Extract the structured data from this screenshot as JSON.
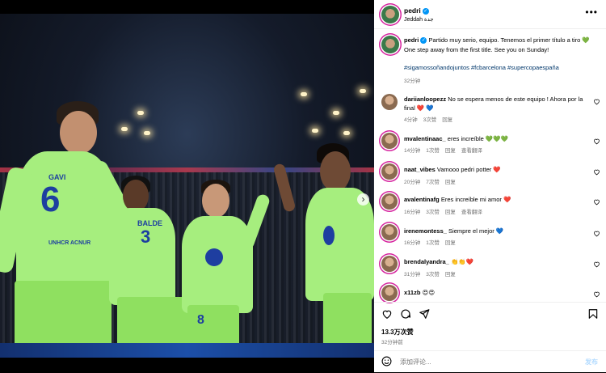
{
  "post": {
    "username": "pedri",
    "location": "Jeddah جدة",
    "caption": "Partido muy serio, equipo. Tenemos el primer título a tiro 💚 One step away from the first title. See you on Sunday!",
    "hashtags": "#sigamossoñandojuntos #fcbarcelona #supercopaespaña",
    "caption_time": "32分钟",
    "more_icon": "more-horizontal-icon",
    "verified_icon": "verified-badge-icon",
    "next_icon": "chevron-right-icon"
  },
  "photo": {
    "players": [
      {
        "name": "GAVI",
        "number": "6"
      },
      {
        "name": "BALDE",
        "number": "3"
      },
      {
        "name": "",
        "number": "8"
      }
    ],
    "sponsor_text": "UNHCR ACNUR"
  },
  "comments": [
    {
      "user": "dariianloopezz",
      "text": "No se espera menos de este equipo ! Ahora por la final ❤️ 💙",
      "time": "4分钟",
      "likes": "3次赞",
      "reply": "回复",
      "translate": ""
    },
    {
      "user": "mvalentinaac_",
      "text": "eres increíble 💚💚💚",
      "time": "14分钟",
      "likes": "1次赞",
      "reply": "回复",
      "translate": "查看翻译"
    },
    {
      "user": "naat_vibes",
      "text": "Vamooo pedri potter ❤️",
      "time": "20分钟",
      "likes": "7次赞",
      "reply": "回复",
      "translate": ""
    },
    {
      "user": "avalentinafg",
      "text": "Eres increíble mi amor ❤️",
      "time": "16分钟",
      "likes": "3次赞",
      "reply": "回复",
      "translate": "查看翻译"
    },
    {
      "user": "irenemontess_",
      "text": "Siempre el mejor 💙",
      "time": "16分钟",
      "likes": "1次赞",
      "reply": "回复",
      "translate": ""
    },
    {
      "user": "brendalyandra_",
      "text": "👏👏❤️",
      "time": "31分钟",
      "likes": "3次赞",
      "reply": "回复",
      "translate": ""
    },
    {
      "user": "x11zb",
      "text": "😍😍",
      "time": "",
      "likes": "",
      "reply": "",
      "translate": ""
    }
  ],
  "actions": {
    "like_icon": "heart-icon",
    "comment_icon": "comment-icon",
    "share_icon": "share-icon",
    "save_icon": "bookmark-icon",
    "likes_count": "13.3万次赞",
    "post_time": "32分钟前"
  },
  "comment_box": {
    "emoji_icon": "smiley-icon",
    "placeholder": "添加评论...",
    "post_label": "发布"
  }
}
